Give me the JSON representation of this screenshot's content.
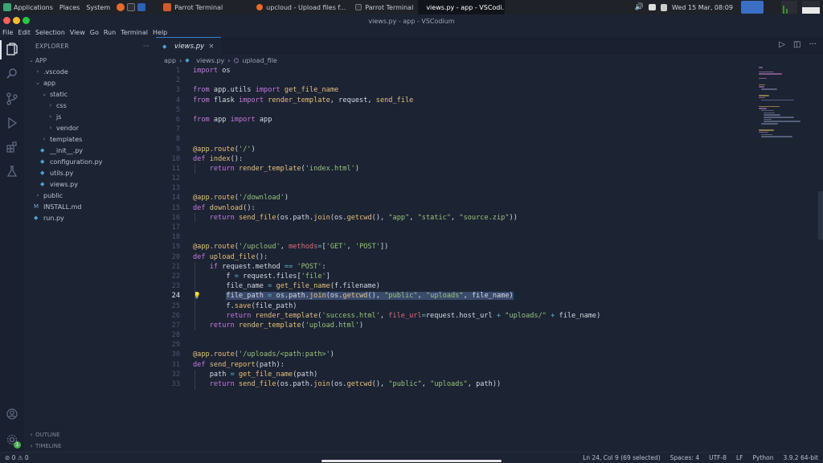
{
  "topbar": {
    "menus": [
      "Applications",
      "Places",
      "System"
    ],
    "tasks": [
      {
        "label": "Parrot Terminal",
        "icon": "terminal-icon"
      },
      {
        "label": "upcloud - Upload files f...",
        "icon": "firefox-icon"
      },
      {
        "label": "Parrot Terminal",
        "icon": "terminal-icon"
      },
      {
        "label": "views.py - app - VSCodi...",
        "icon": "vscodium-icon"
      }
    ],
    "clock": "Wed 15 Mar, 08:09"
  },
  "window": {
    "title": "views.py - app - VSCodium"
  },
  "menubar": [
    "File",
    "Edit",
    "Selection",
    "View",
    "Go",
    "Run",
    "Terminal",
    "Help"
  ],
  "activity_bar": [
    "files-icon",
    "search-icon",
    "source-control-icon",
    "run-debug-icon",
    "extensions-icon",
    "testing-icon"
  ],
  "explorer": {
    "header": "EXPLORER",
    "more": "···",
    "root": "APP",
    "tree": [
      {
        "label": ".vscode",
        "type": "folder",
        "depth": 1,
        "open": false
      },
      {
        "label": "app",
        "type": "folder",
        "depth": 1,
        "open": true
      },
      {
        "label": "static",
        "type": "folder",
        "depth": 2,
        "open": true
      },
      {
        "label": "css",
        "type": "folder",
        "depth": 3,
        "open": false
      },
      {
        "label": "js",
        "type": "folder",
        "depth": 3,
        "open": false
      },
      {
        "label": "vendor",
        "type": "folder",
        "depth": 3,
        "open": false
      },
      {
        "label": "templates",
        "type": "folder",
        "depth": 2,
        "open": false
      },
      {
        "label": "__init__.py",
        "type": "file",
        "depth": 2
      },
      {
        "label": "configuration.py",
        "type": "file",
        "depth": 2
      },
      {
        "label": "utils.py",
        "type": "file",
        "depth": 2
      },
      {
        "label": "views.py",
        "type": "file",
        "depth": 2
      },
      {
        "label": "public",
        "type": "folder",
        "depth": 1,
        "open": false
      },
      {
        "label": "INSTALL.md",
        "type": "md",
        "depth": 1
      },
      {
        "label": "run.py",
        "type": "file",
        "depth": 1
      }
    ],
    "outline": "OUTLINE",
    "timeline": "TIMELINE"
  },
  "editor": {
    "tab": {
      "label": "views.py",
      "close": "×"
    },
    "breadcrumb": [
      "app",
      "views.py",
      "upload_file"
    ],
    "current_line": 24,
    "lines": [
      "import os",
      "",
      "from app.utils import get_file_name",
      "from flask import render_template, request, send_file",
      "",
      "from app import app",
      "",
      "",
      "@app.route('/')",
      "def index():",
      "    return render_template('index.html')",
      "",
      "",
      "@app.route('/download')",
      "def download():",
      "    return send_file(os.path.join(os.getcwd(), \"app\", \"static\", \"source.zip\"))",
      "",
      "",
      "@app.route('/upcloud', methods=['GET', 'POST'])",
      "def upload_file():",
      "    if request.method == 'POST':",
      "        f = request.files['file']",
      "        file_name = get_file_name(f.filename)",
      "        file_path = os.path.join(os.getcwd(), \"public\", \"uploads\", file_name)",
      "        f.save(file_path)",
      "        return render_template('success.html', file_url=request.host_url + \"uploads/\" + file_name)",
      "    return render_template('upload.html')",
      "",
      "",
      "@app.route('/uploads/<path:path>')",
      "def send_report(path):",
      "    path = get_file_name(path)",
      "    return send_file(os.path.join(os.getcwd(), \"public\", \"uploads\", path))"
    ]
  },
  "statusbar": {
    "problems": "⊘ 0 ⚠ 0",
    "position": "Ln 24, Col 9 (69 selected)",
    "spaces": "Spaces: 4",
    "encoding": "UTF-8",
    "eol": "LF",
    "language": "Python",
    "interpreter": "3.9.2 64-bit"
  },
  "colors": {
    "accent": "#3a7bd5",
    "background": "#1c2333",
    "selection": "#3a4a6b"
  }
}
